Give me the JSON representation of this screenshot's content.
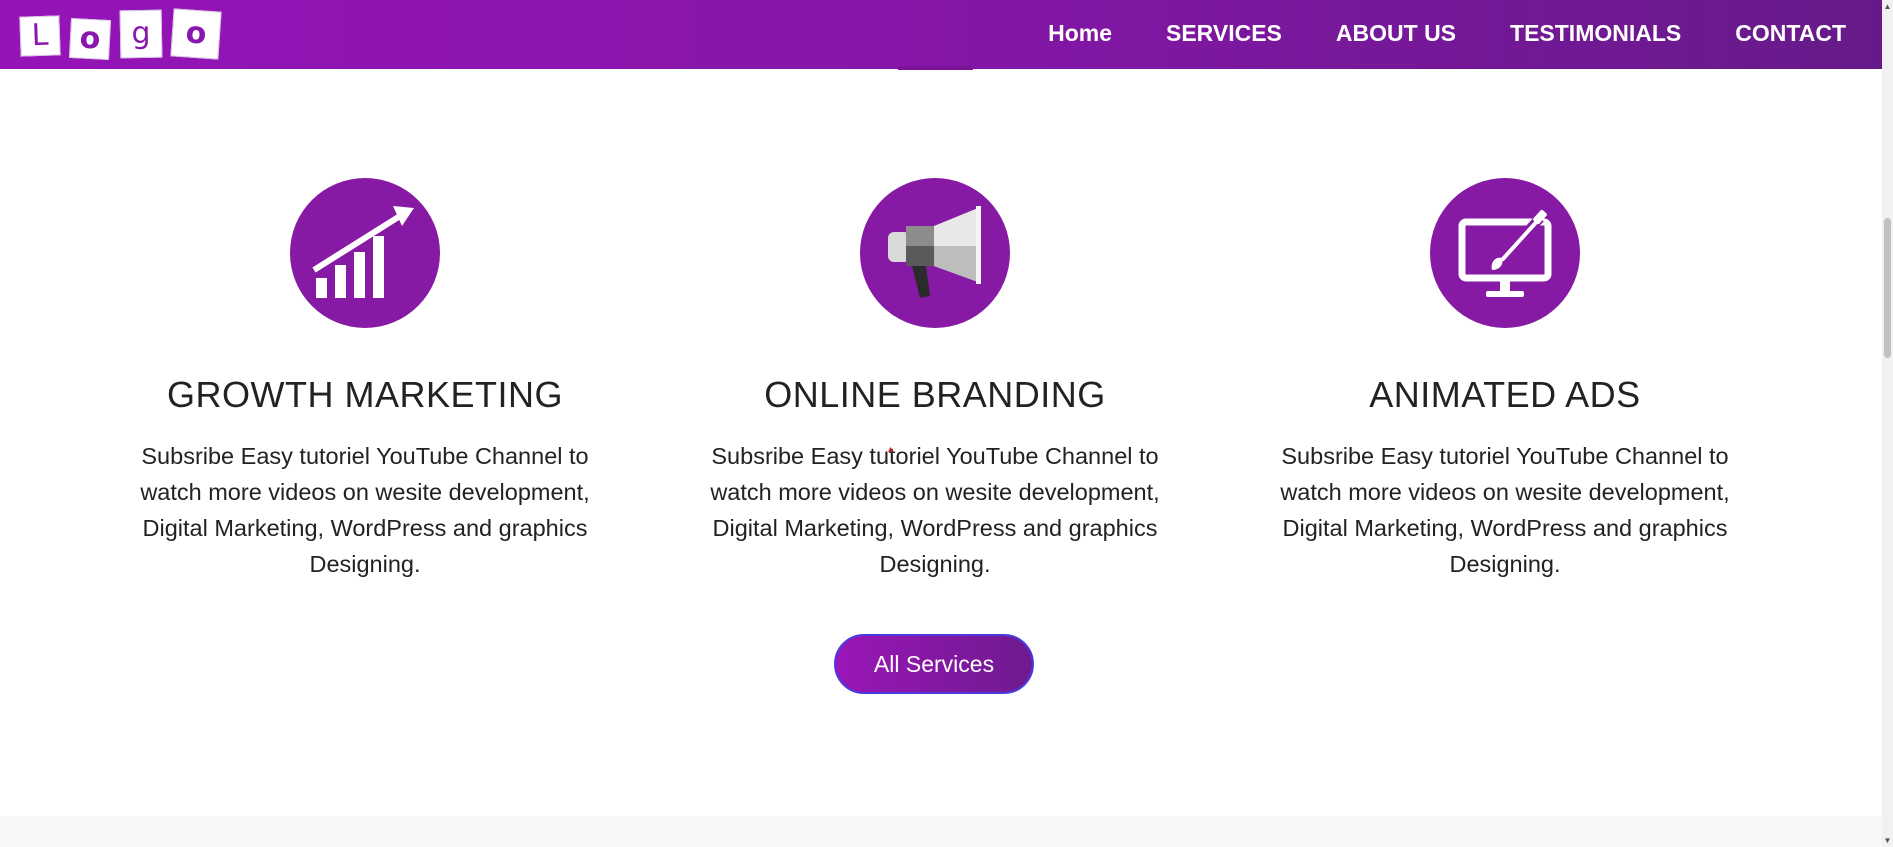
{
  "logo": {
    "letters": [
      "L",
      "o",
      "g",
      "o"
    ]
  },
  "nav": {
    "items": [
      "Home",
      "SERVICES",
      "ABOUT US",
      "TESTIMONIALS",
      "CONTACT"
    ]
  },
  "services": [
    {
      "icon": "growth-chart-icon",
      "title": "GROWTH MARKETING",
      "text": "Subsribe Easy tutoriel YouTube Channel to watch more videos on wesite development, Digital Marketing, WordPress and graphics Designing."
    },
    {
      "icon": "megaphone-icon",
      "title": "ONLINE BRANDING",
      "text": "Subsribe Easy tutoriel YouTube Channel to watch more videos on wesite development, Digital Marketing, WordPress and graphics Designing."
    },
    {
      "icon": "monitor-brush-icon",
      "title": "ANIMATED ADS",
      "text": "Subsribe Easy tutoriel YouTube Channel to watch more videos on wesite development, Digital Marketing, WordPress and graphics Designing."
    }
  ],
  "cta": {
    "label": "All Services"
  },
  "colors": {
    "brand_purple": "#861aa5",
    "nav_gradient_start": "#9514b8",
    "nav_gradient_end": "#661a89",
    "text_dark": "#222222"
  }
}
